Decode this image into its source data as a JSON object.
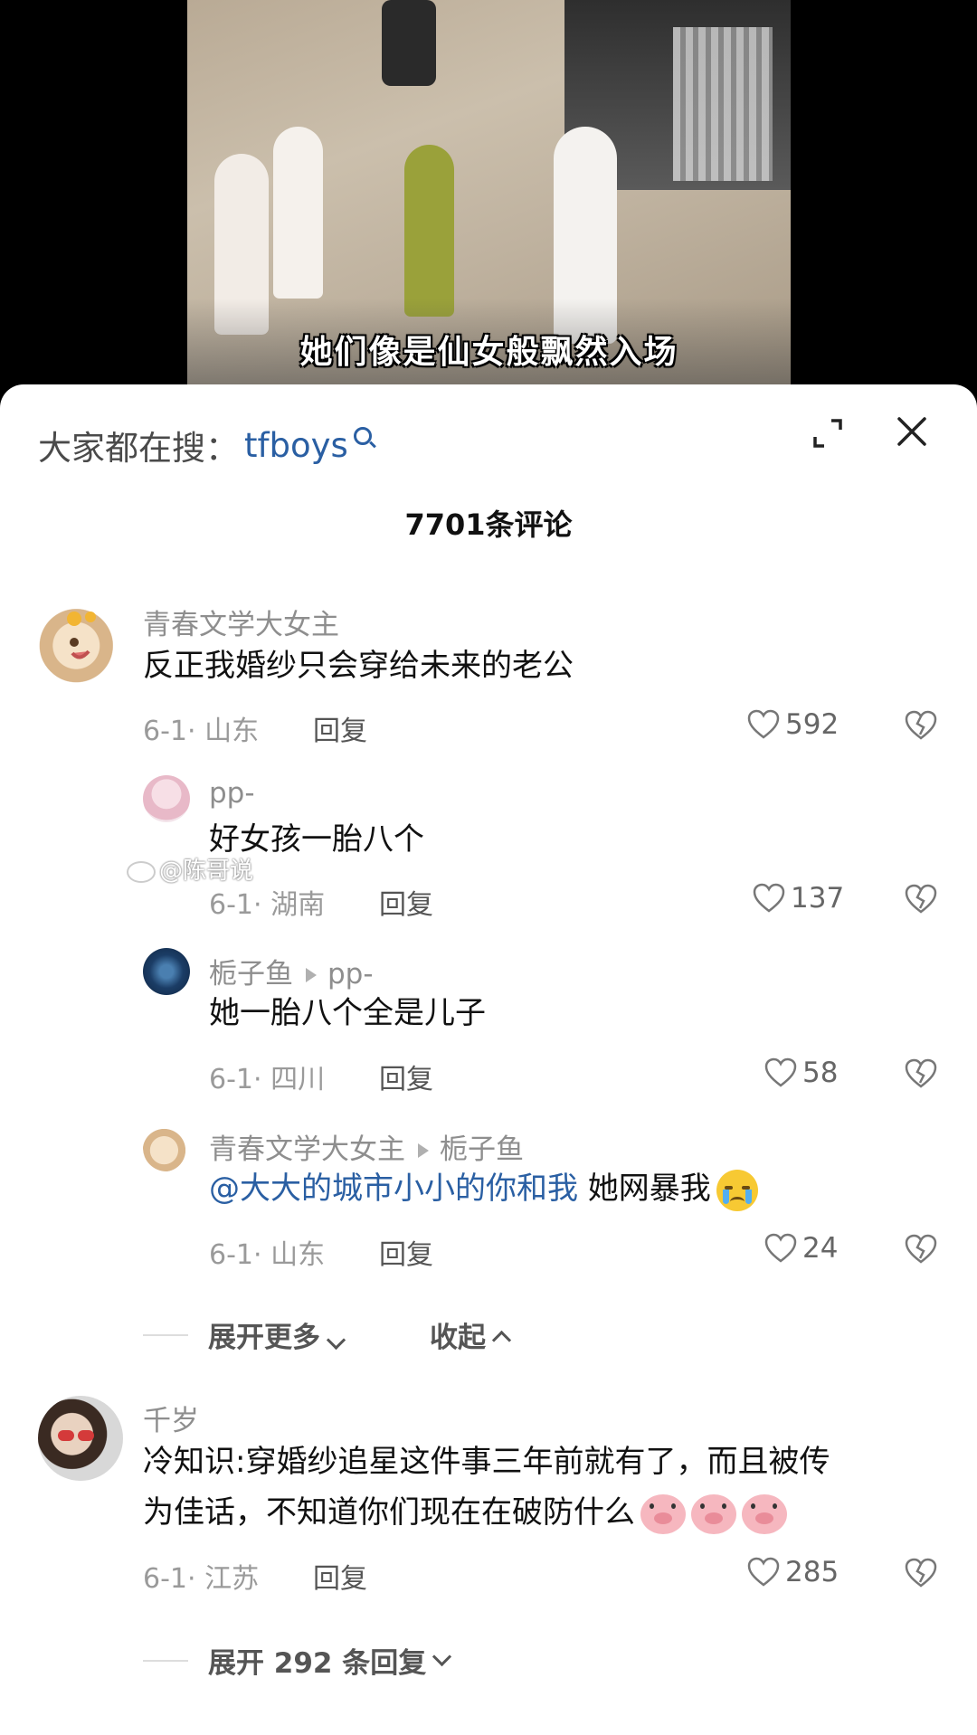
{
  "video": {
    "caption": "她们像是仙女般飘然入场"
  },
  "header": {
    "search_prefix": "大家都在搜：",
    "search_term": "tfboys",
    "comment_count": "7701条评论"
  },
  "watermark": "@陈哥说",
  "comments": [
    {
      "user": "青春文学大女主",
      "text": "反正我婚纱只会穿给未来的老公",
      "date_location": "6-1· 山东",
      "reply_label": "回复",
      "likes": "592"
    },
    {
      "user": "pp-",
      "text": "好女孩一胎八个",
      "date_location": "6-1· 湖南",
      "reply_label": "回复",
      "likes": "137"
    },
    {
      "user": "栀子鱼",
      "reply_to": "pp-",
      "text": "她一胎八个全是儿子",
      "date_location": "6-1· 四川",
      "reply_label": "回复",
      "likes": "58"
    },
    {
      "user": "青春文学大女主",
      "reply_to": "栀子鱼",
      "mention": "@大大的城市小小的你和我",
      "text": " 她网暴我",
      "emoji": "loudly-crying-face",
      "date_location": "6-1· 山东",
      "reply_label": "回复",
      "likes": "24"
    },
    {
      "user": "千岁",
      "text_line1": "冷知识:穿婚纱追星这件事三年前就有了，而且被传",
      "text_line2": "为佳话，不知道你们现在在破防什么",
      "emoji": "pig-face",
      "date_location": "6-1· 江苏",
      "reply_label": "回复",
      "likes": "285"
    }
  ],
  "thread_controls": {
    "expand_more": "展开更多",
    "collapse": "收起",
    "expand_replies": "展开 292 条回复"
  }
}
